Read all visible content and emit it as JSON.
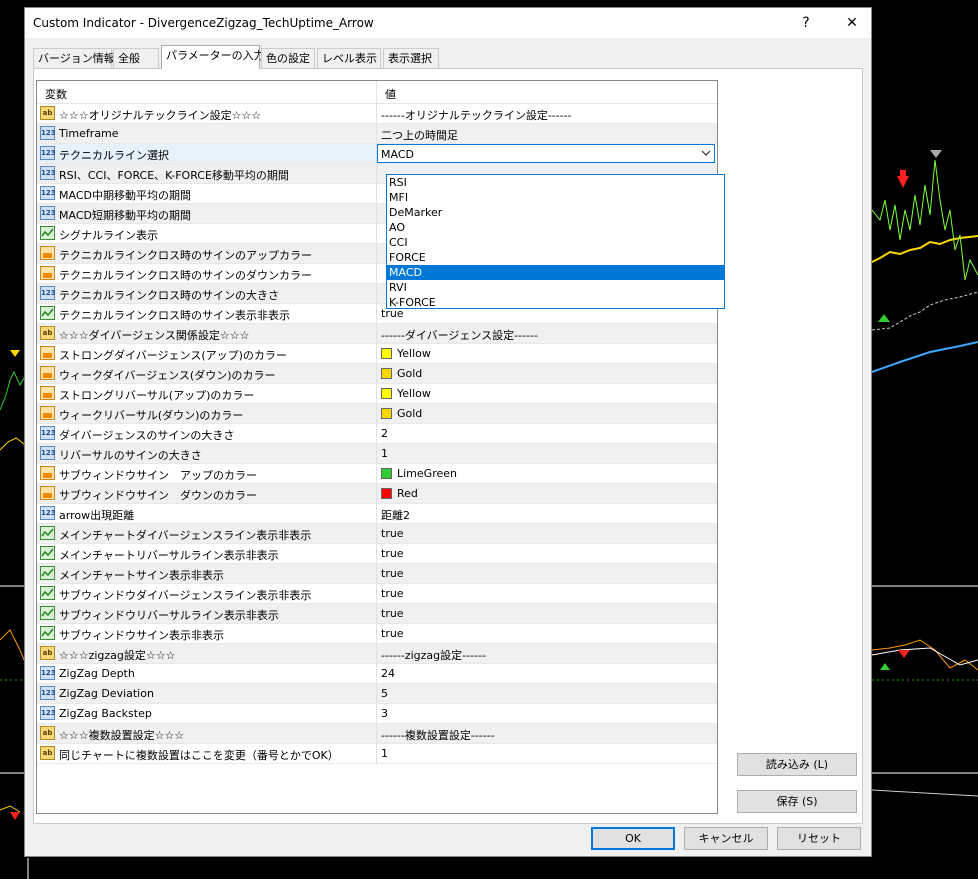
{
  "window": {
    "title": "Custom Indicator - DivergenceZigzag_TechUptime_Arrow",
    "help": "?",
    "close": "✕"
  },
  "tabs": [
    {
      "label": "バージョン情報",
      "active": false
    },
    {
      "label": "全般",
      "active": false
    },
    {
      "label": "パラメーターの入力",
      "active": true
    },
    {
      "label": "色の設定",
      "active": false
    },
    {
      "label": "レベル表示",
      "active": false
    },
    {
      "label": "表示選択",
      "active": false
    }
  ],
  "grid": {
    "headers": {
      "name": "変数",
      "value": "値"
    },
    "rows": [
      {
        "icon": "ab",
        "name": "☆☆☆オリジナルテックライン設定☆☆☆",
        "value": "------オリジナルテックライン設定------"
      },
      {
        "icon": "num",
        "name": "Timeframe",
        "value": "二つ上の時間足"
      },
      {
        "icon": "num",
        "name": "テクニカルライン選択",
        "value": "MACD",
        "combo": true
      },
      {
        "icon": "num",
        "name": "RSI、CCI、FORCE、K-FORCE移動平均の期間",
        "value": ""
      },
      {
        "icon": "num",
        "name": "MACD中期移動平均の期間",
        "value": ""
      },
      {
        "icon": "num",
        "name": "MACD短期移動平均の期間",
        "value": ""
      },
      {
        "icon": "bool",
        "name": "シグナルライン表示",
        "value": ""
      },
      {
        "icon": "color",
        "name": "テクニカルラインクロス時のサインのアップカラー",
        "value": ""
      },
      {
        "icon": "color",
        "name": "テクニカルラインクロス時のサインのダウンカラー",
        "value": ""
      },
      {
        "icon": "num",
        "name": "テクニカルラインクロス時のサインの大きさ",
        "value": ""
      },
      {
        "icon": "bool",
        "name": "テクニカルラインクロス時のサイン表示非表示",
        "value": "true"
      },
      {
        "icon": "ab",
        "name": "☆☆☆ダイバージェンス関係設定☆☆☆",
        "value": "------ダイバージェンス設定------"
      },
      {
        "icon": "color",
        "name": "ストロングダイバージェンス(アップ)のカラー",
        "value": "Yellow",
        "swatch": "#ffff00"
      },
      {
        "icon": "color",
        "name": "ウィークダイバージェンス(ダウン)のカラー",
        "value": "Gold",
        "swatch": "#ffd700"
      },
      {
        "icon": "color",
        "name": "ストロングリバーサル(アップ)のカラー",
        "value": "Yellow",
        "swatch": "#ffff00"
      },
      {
        "icon": "color",
        "name": "ウィークリバーサル(ダウン)のカラー",
        "value": "Gold",
        "swatch": "#ffd700"
      },
      {
        "icon": "num",
        "name": "ダイバージェンスのサインの大きさ",
        "value": "2"
      },
      {
        "icon": "num",
        "name": "リバーサルのサインの大きさ",
        "value": "1"
      },
      {
        "icon": "color",
        "name": "サブウィンドウサイン　アップのカラー",
        "value": "LimeGreen",
        "swatch": "#32cd32"
      },
      {
        "icon": "color",
        "name": "サブウィンドウサイン　ダウンのカラー",
        "value": "Red",
        "swatch": "#ff0000"
      },
      {
        "icon": "num",
        "name": "arrow出現距離",
        "value": "距離2"
      },
      {
        "icon": "bool",
        "name": "メインチャートダイバージェンスライン表示非表示",
        "value": "true"
      },
      {
        "icon": "bool",
        "name": "メインチャートリバーサルライン表示非表示",
        "value": "true"
      },
      {
        "icon": "bool",
        "name": "メインチャートサイン表示非表示",
        "value": "true"
      },
      {
        "icon": "bool",
        "name": "サブウィンドウダイバージェンスライン表示非表示",
        "value": "true"
      },
      {
        "icon": "bool",
        "name": "サブウィンドウリバーサルライン表示非表示",
        "value": "true"
      },
      {
        "icon": "bool",
        "name": "サブウィンドウサイン表示非表示",
        "value": "true"
      },
      {
        "icon": "ab",
        "name": "☆☆☆zigzag設定☆☆☆",
        "value": "------zigzag設定------"
      },
      {
        "icon": "num",
        "name": "ZigZag Depth",
        "value": "24"
      },
      {
        "icon": "num",
        "name": "ZigZag Deviation",
        "value": "5"
      },
      {
        "icon": "num",
        "name": "ZigZag Backstep",
        "value": "3"
      },
      {
        "icon": "ab",
        "name": "☆☆☆複数設置設定☆☆☆",
        "value": "------複数設置設定------"
      },
      {
        "icon": "ab",
        "name": "同じチャートに複数設置はここを変更（番号とかでOK）",
        "value": "1"
      }
    ]
  },
  "dropdown": {
    "options": [
      "RSI",
      "MFI",
      "DeMarker",
      "AO",
      "CCI",
      "FORCE",
      "MACD",
      "RVI",
      "K-FORCE"
    ],
    "selected": "MACD"
  },
  "buttons": {
    "load": "読み込み (L)",
    "save": "保存 (S)",
    "ok": "OK",
    "cancel": "キャンセル",
    "reset": "リセット"
  }
}
